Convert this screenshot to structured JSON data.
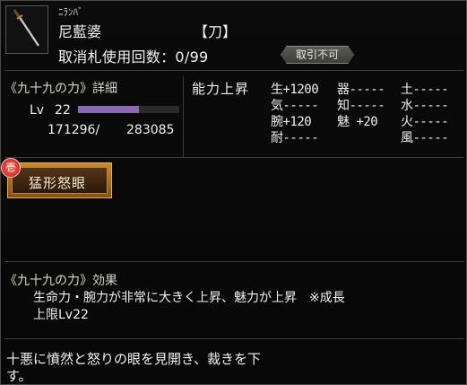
{
  "item": {
    "ruby": "ﾆﾗﾝﾊﾞ",
    "name": "尼藍婆",
    "kind": "【刀】",
    "uses": "取消札使用回数：0/99",
    "trade_badge": "取引不可",
    "icon": "katana-icon"
  },
  "detail": {
    "title": "《九十九の力》詳細",
    "level_label": "Lv",
    "level": "22",
    "exp_current": "171296/",
    "exp_max": "283085",
    "exp_progress": 0.605
  },
  "ability": {
    "title": "能力上昇",
    "stats": [
      {
        "label": "生",
        "value": "+1200"
      },
      {
        "label": "器",
        "value": "-----"
      },
      {
        "label": "土",
        "value": "-----"
      },
      {
        "label": "気",
        "value": "-----"
      },
      {
        "label": "知",
        "value": "-----"
      },
      {
        "label": "水",
        "value": "-----"
      },
      {
        "label": "腕",
        "value": "+120"
      },
      {
        "label": "魅",
        "value": "+20"
      },
      {
        "label": "火",
        "value": "-----"
      },
      {
        "label": "耐",
        "value": "-----"
      },
      {
        "label": "風",
        "value": "-----"
      }
    ]
  },
  "skill": {
    "badge": "壱",
    "name": "猛形怒眼"
  },
  "effect": {
    "title": "《九十九の力》効果",
    "line1": "生命力・腕力が非常に大きく上昇、魅力が上昇　※成長",
    "line2": "上限Lv22"
  },
  "flavor": {
    "line1": "十悪に憤然と怒りの眼を見開き、裁きを下",
    "line2": "す。"
  },
  "colors": {
    "exp_bar": "#8a6ab0",
    "skill_frame": "#c98a2a",
    "badge_red": "#c01818"
  }
}
